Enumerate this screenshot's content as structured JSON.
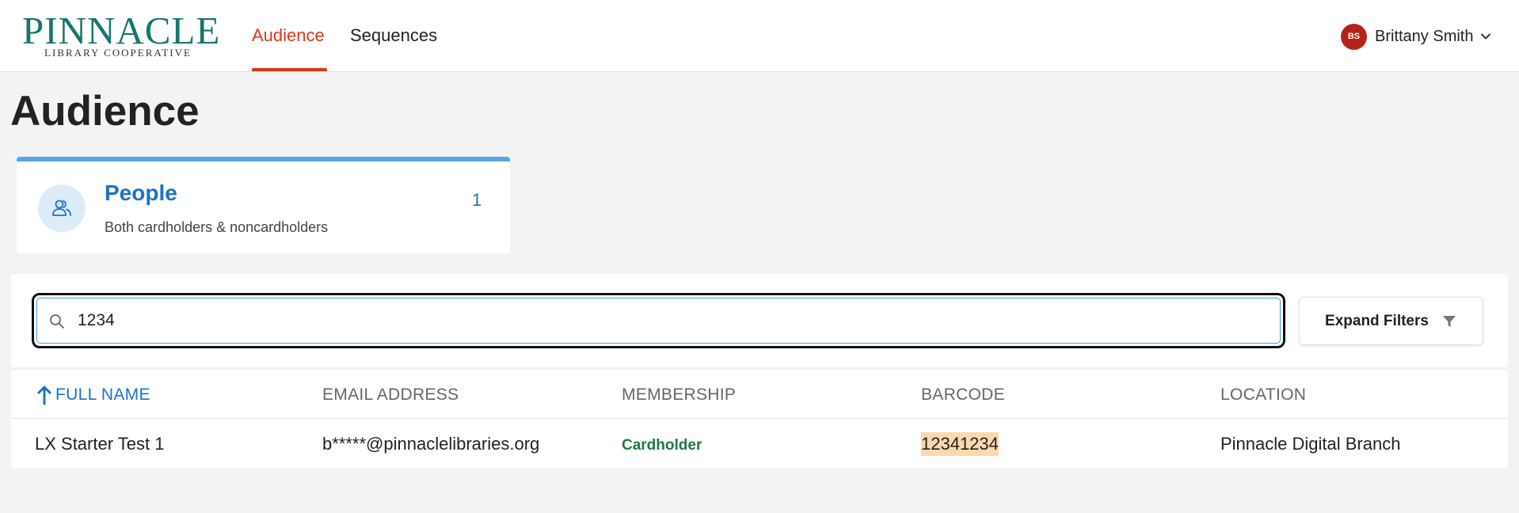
{
  "brand": {
    "name": "PINNACLE",
    "subtitle": "LIBRARY COOPERATIVE",
    "color": "#17766f"
  },
  "nav": {
    "tabs": [
      {
        "label": "Audience",
        "active": true
      },
      {
        "label": "Sequences",
        "active": false
      }
    ],
    "accent_color": "#d9381e"
  },
  "user": {
    "initials": "BS",
    "name": "Brittany Smith",
    "avatar_color": "#b42318",
    "icon": "chevron-down-icon"
  },
  "page": {
    "title": "Audience"
  },
  "people_card": {
    "title": "People",
    "subtitle": "Both cardholders & noncardholders",
    "count": "1",
    "icon": "people-icon",
    "accent_color": "#58a6e8"
  },
  "search": {
    "value": "1234",
    "icon": "search-icon"
  },
  "filters": {
    "label": "Expand Filters",
    "icon": "filter-icon"
  },
  "table": {
    "columns": [
      "FULL NAME",
      "EMAIL ADDRESS",
      "MEMBERSHIP",
      "BARCODE",
      "LOCATION"
    ],
    "sort": {
      "column": "FULL NAME",
      "direction": "ascending",
      "icon": "arrow-up-icon"
    },
    "rows": [
      {
        "full_name": "LX Starter Test 1",
        "email": "b*****@pinnaclelibraries.org",
        "membership": "Cardholder",
        "barcode": "12341234",
        "barcode_highlight": "highlighted",
        "location": "Pinnacle Digital Branch"
      }
    ],
    "membership_color": "#1f7a45",
    "highlight_color": "#fcd9ad"
  }
}
